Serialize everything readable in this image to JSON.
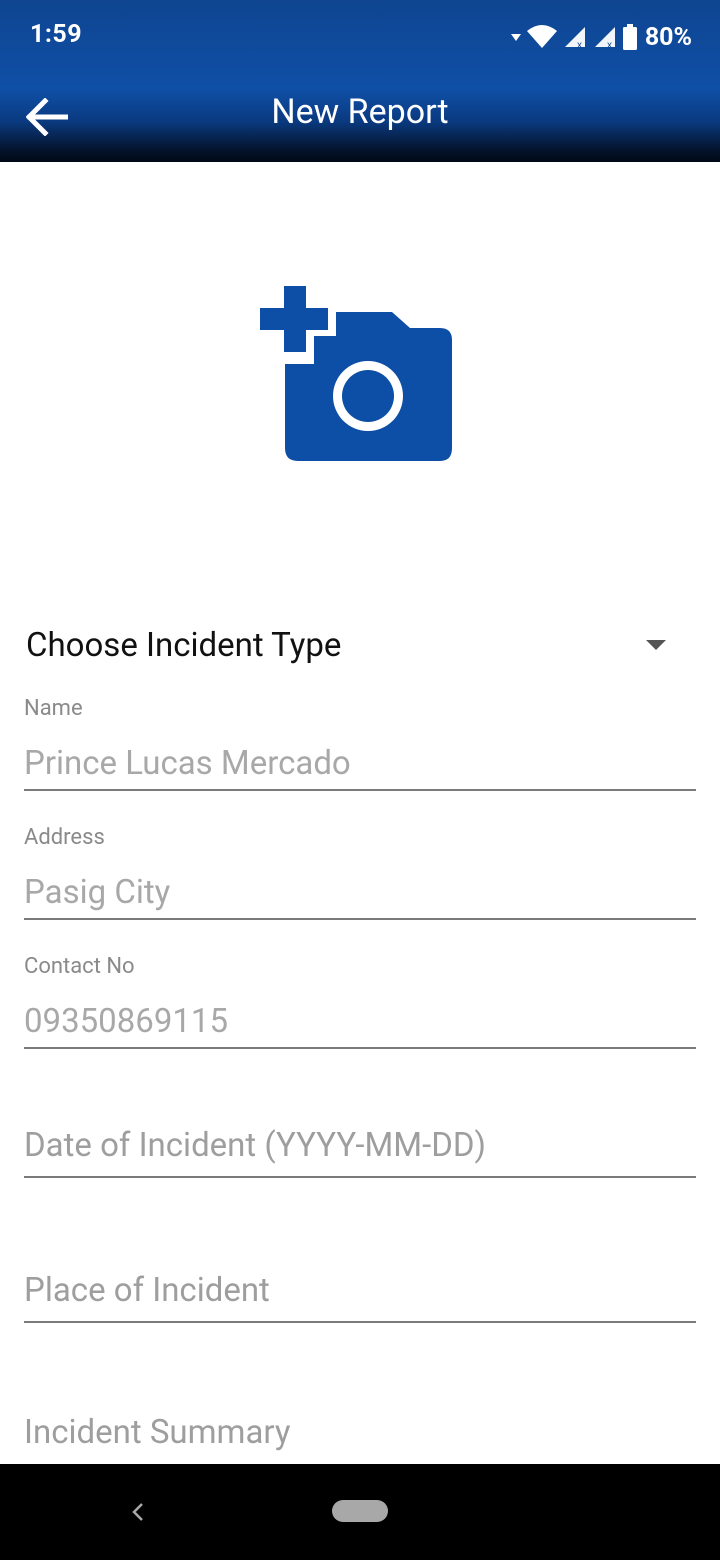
{
  "status_bar": {
    "time": "1:59",
    "battery": "80%",
    "icons": [
      "data-arrow-icon",
      "wifi-icon",
      "signal-icon",
      "signal-icon",
      "battery-icon"
    ]
  },
  "toolbar": {
    "title": "New Report",
    "back_icon": "arrow-left-icon"
  },
  "photo": {
    "icon": "add-a-photo-icon",
    "color": "#0d4ea6"
  },
  "incident_type": {
    "label": "Choose Incident Type",
    "icon": "dropdown-arrow-icon"
  },
  "form": {
    "name": {
      "label": "Name",
      "value": "Prince Lucas Mercado"
    },
    "address": {
      "label": "Address",
      "value": "Pasig City"
    },
    "contact": {
      "label": "Contact No",
      "value": "09350869115"
    },
    "date": {
      "placeholder": "Date of Incident (YYYY-MM-DD)"
    },
    "place": {
      "placeholder": "Place of Incident"
    },
    "summary": {
      "placeholder": "Incident Summary"
    }
  },
  "colors": {
    "header": "#0f4fa6",
    "accent": "#0d4ea6",
    "nav_bar": "#000000"
  }
}
